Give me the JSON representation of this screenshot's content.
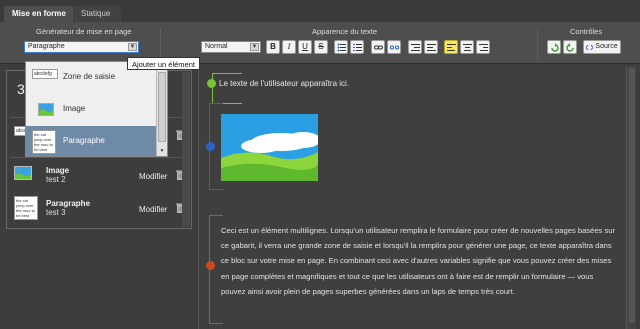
{
  "tabs": [
    {
      "label": "Mise en forme",
      "active": true
    },
    {
      "label": "Statique",
      "active": false
    }
  ],
  "toolbar": {
    "generator_label": "Générateur de mise en page",
    "generator_value": "Paragraphe",
    "text_appearance_label": "Apparence du texte",
    "style_value": "Normal",
    "bold": "B",
    "italic": "I",
    "underline": "U",
    "strike": "S",
    "controls_label": "Contrôles",
    "source_label": "Source",
    "active_color": "#f6e85a"
  },
  "tooltip": "Ajouter un élément",
  "dropdown": {
    "items": [
      {
        "label": "Zone de saisie",
        "thumb_text": "abcdefg"
      },
      {
        "label": "Image"
      },
      {
        "label": "Paragraphe",
        "thumb_text": "the cat jump over the moo to be best"
      }
    ]
  },
  "left_panel": {
    "count": "3",
    "rows": [
      {
        "title": "",
        "sub": "",
        "action": "",
        "thumb_text": "abcdefg"
      },
      {
        "title": "Image",
        "sub": "test 2",
        "action": "Modifier"
      },
      {
        "title": "Paragraphe",
        "sub": "test 3",
        "action": "Modifier",
        "thumb_text": "the cat jump over the moo to be best"
      }
    ]
  },
  "canvas": {
    "input_text": "Le texte de l'utilisateur apparaîtra ici.",
    "paragraph": "Ceci est un élément multilignes. Lorsqu'un utilisateur remplira le formulaire pour créer de nouvelles pages basées sur ce gabarit, il verra une grande zone de saisie et lorsqu'il la remplira pour générer une page, ce texte apparaîtra dans ce bloc sur votre mise en page. En combinant ceci avec d'autres variables signifie que vous pouvez créer des mises en page complètes et magnifiques et tout ce que les utilisateurs ont à faire est de remplir un formulaire — vous pouvez ainsi avoir plein de pages superbes générées dans un laps de temps très court.",
    "marker_colors": {
      "green": "#7cc234",
      "blue": "#2a63c8",
      "red": "#cc4a1c"
    }
  }
}
